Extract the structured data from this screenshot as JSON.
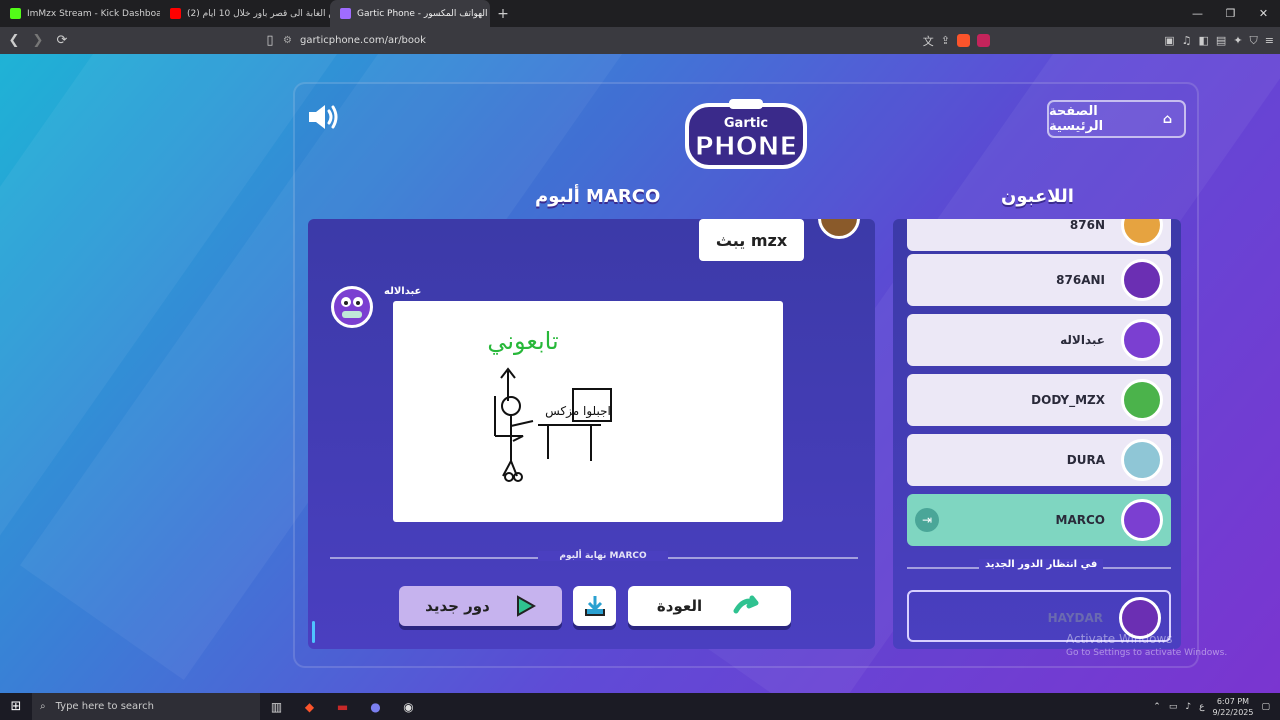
{
  "browser": {
    "tabs": [
      {
        "label": "ImMzx Stream - Kick Dashboard",
        "color": "#53fc18"
      },
      {
        "label": "(2) من الغابة الى قصر باور خلال 10 ايام",
        "color": "#ff0000"
      },
      {
        "label": "Gartic Phone - لعبة الهواتف المكسور",
        "color": "#a06cff"
      }
    ],
    "new_tab_label": "+",
    "url": "garticphone.com/ar/book",
    "win_min": "—",
    "win_restore": "❐",
    "win_close": "✕"
  },
  "game": {
    "home_label": "الصفحة الرئيسية",
    "players_title": "اللاعبون",
    "album_title": "ألبوم MARCO",
    "logo_text_top": "Gartic",
    "logo_text_main": "PHONE",
    "prompt_text": "يبث mzx",
    "author_name": "عبدالاله",
    "drawing_text": "تابعوني",
    "drawing_screen_text": "اجبلوا مزكس",
    "end_album_label": "نهاية ألبوم MARCO",
    "new_round_label": "دور جديد",
    "back_label": "العودة",
    "waiting_label": "في انتظار الدور الجديد",
    "players": [
      {
        "name": "876N"
      },
      {
        "name": "876ANI"
      },
      {
        "name": "عبدالاله"
      },
      {
        "name": "DODY_MZX"
      },
      {
        "name": "DURA"
      },
      {
        "name": "MARCO"
      }
    ],
    "waiting_player": {
      "name": "HAYDAR"
    }
  },
  "watermark": {
    "line1": "Activate Windows",
    "line2": "Go to Settings to activate Windows."
  },
  "taskbar": {
    "search_placeholder": "Type here to search",
    "lang": "ع",
    "time": "6:07 PM",
    "date": "9/22/2025"
  }
}
